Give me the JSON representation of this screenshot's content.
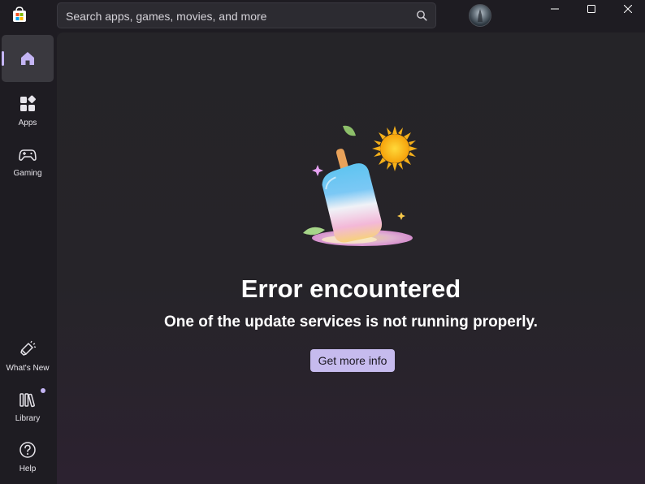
{
  "titlebar": {
    "logo_icon": "microsoft-store-icon",
    "minimize_icon": "minimize-icon",
    "maximize_icon": "maximize-icon",
    "close_icon": "close-icon"
  },
  "search": {
    "placeholder": "Search apps, games, movies, and more",
    "icon": "search-icon"
  },
  "user": {
    "avatar": "user-avatar"
  },
  "sidebar": {
    "items": [
      {
        "label": "",
        "icon": "home-icon",
        "active": true
      },
      {
        "label": "Apps",
        "icon": "apps-icon",
        "active": false
      },
      {
        "label": "Gaming",
        "icon": "gamepad-icon",
        "active": false
      },
      {
        "label": "What's New",
        "icon": "megaphone-icon",
        "active": false
      },
      {
        "label": "Library",
        "icon": "library-icon",
        "active": false,
        "badge": true
      },
      {
        "label": "Help",
        "icon": "help-icon",
        "active": false
      }
    ]
  },
  "main": {
    "illustration": "melting-popsicle-illustration",
    "error_title": "Error encountered",
    "error_message": "One of the update services is not running properly.",
    "button_label": "Get more info"
  },
  "colors": {
    "accent": "#c4b5f4",
    "button_bg": "#c6bbee",
    "background": "#1f1d23"
  }
}
